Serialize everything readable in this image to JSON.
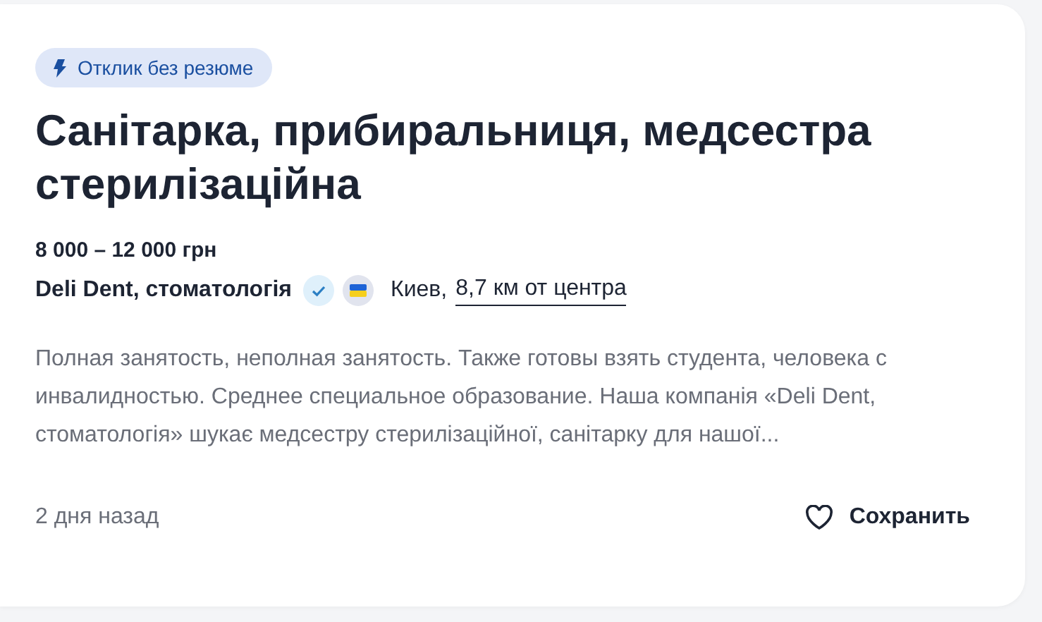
{
  "badge": {
    "label": "Отклик без резюме"
  },
  "title": "Санітарка, прибиральниця, медсестра стерилізаційна",
  "salary": "8 000 – 12 000 грн",
  "company": {
    "name": "Deli Dent, стоматологія",
    "verified": true
  },
  "location": {
    "city": "Киев,",
    "distance": "8,7 км от центра"
  },
  "description": "Полная занятость, неполная занятость. Также готовы взять студента, человека с инвалидностью. Среднее специальное образование. Наша компанія «Deli Dent, стоматологія» шукає медсестру стерилізаційної, санітарку для нашої...",
  "posted": "2 дня назад",
  "save": {
    "label": "Сохранить",
    "saved": false
  }
}
